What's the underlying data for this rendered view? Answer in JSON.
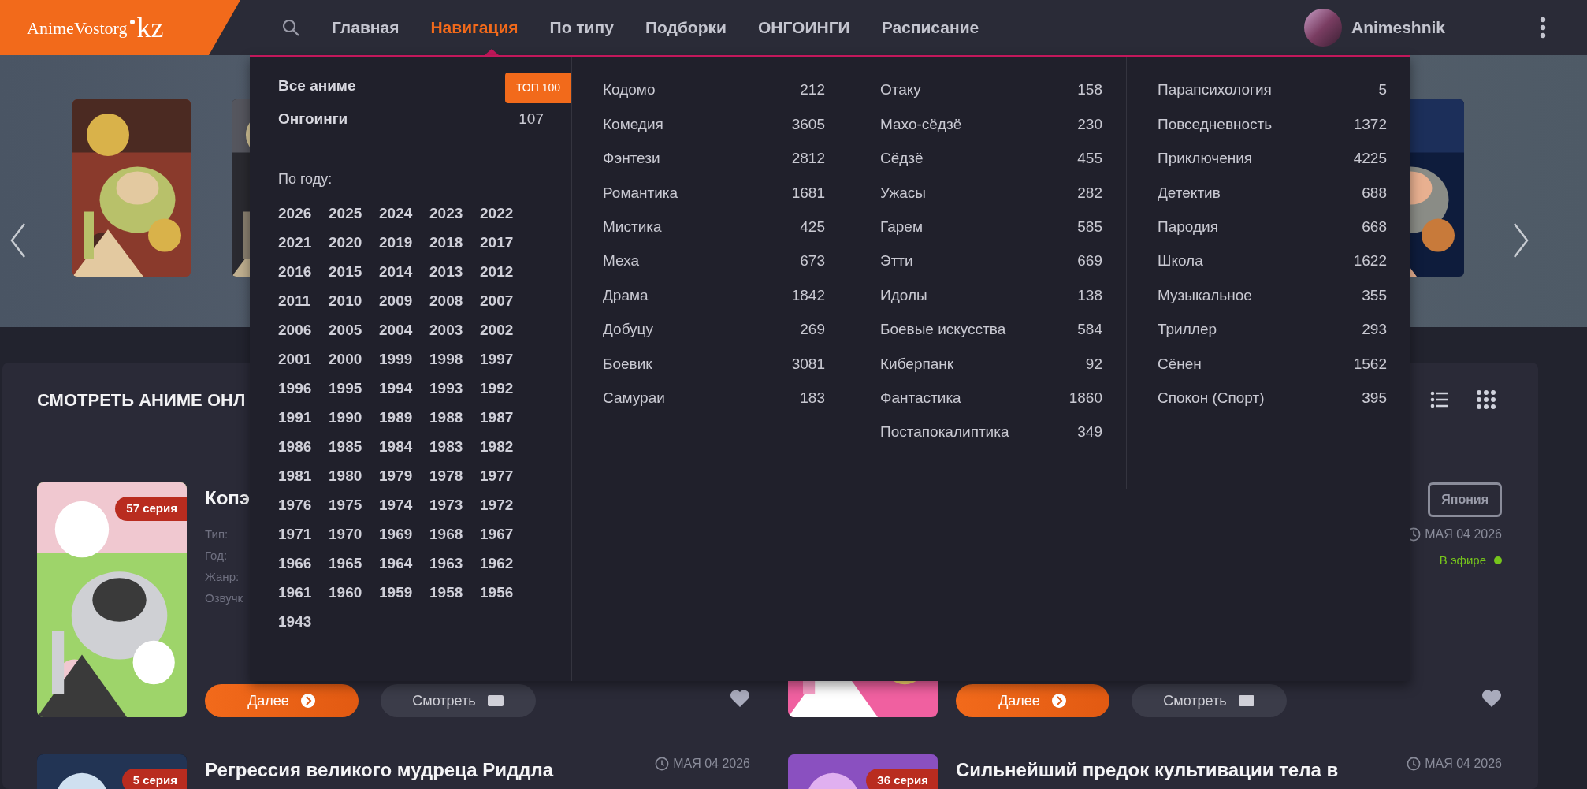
{
  "header": {
    "logo": "AnimeVostorg",
    "logo_domain": "kz",
    "nav": [
      {
        "label": "Главная",
        "selected": false
      },
      {
        "label": "Навигация",
        "selected": true
      },
      {
        "label": "По типу",
        "selected": false
      },
      {
        "label": "Подборки",
        "selected": false
      },
      {
        "label": "ОНГОИНГИ",
        "selected": false
      },
      {
        "label": "Расписание",
        "selected": false
      }
    ],
    "user": "Animeshnik"
  },
  "menu": {
    "all": "Все аниме",
    "top_badge": "ТОП 100",
    "ongoing": {
      "label": "Онгоинги",
      "count": "107"
    },
    "years_label": "По году:",
    "years": [
      "2026",
      "2025",
      "2024",
      "2023",
      "2022",
      "2021",
      "2020",
      "2019",
      "2018",
      "2017",
      "2016",
      "2015",
      "2014",
      "2013",
      "2012",
      "2011",
      "2010",
      "2009",
      "2008",
      "2007",
      "2006",
      "2005",
      "2004",
      "2003",
      "2002",
      "2001",
      "2000",
      "1999",
      "1998",
      "1997",
      "1996",
      "1995",
      "1994",
      "1993",
      "1992",
      "1991",
      "1990",
      "1989",
      "1988",
      "1987",
      "1986",
      "1985",
      "1984",
      "1983",
      "1982",
      "1981",
      "1980",
      "1979",
      "1978",
      "1977",
      "1976",
      "1975",
      "1974",
      "1973",
      "1972",
      "1971",
      "1970",
      "1969",
      "1968",
      "1967",
      "1966",
      "1965",
      "1964",
      "1963",
      "1962",
      "1961",
      "1960",
      "1959",
      "1958",
      "1956",
      "1943"
    ],
    "genre_columns": [
      [
        {
          "name": "Кодомо",
          "count": "212"
        },
        {
          "name": "Комедия",
          "count": "3605"
        },
        {
          "name": "Фэнтези",
          "count": "2812"
        },
        {
          "name": "Романтика",
          "count": "1681"
        },
        {
          "name": "Мистика",
          "count": "425"
        },
        {
          "name": "Меха",
          "count": "673"
        },
        {
          "name": "Драма",
          "count": "1842"
        },
        {
          "name": "Добуцу",
          "count": "269"
        },
        {
          "name": "Боевик",
          "count": "3081"
        },
        {
          "name": "Самураи",
          "count": "183"
        }
      ],
      [
        {
          "name": "Отаку",
          "count": "158"
        },
        {
          "name": "Махо-сёдзё",
          "count": "230"
        },
        {
          "name": "Сёдзё",
          "count": "455"
        },
        {
          "name": "Ужасы",
          "count": "282"
        },
        {
          "name": "Гарем",
          "count": "585"
        },
        {
          "name": "Этти",
          "count": "669"
        },
        {
          "name": "Идолы",
          "count": "138"
        },
        {
          "name": "Боевые искусства",
          "count": "584"
        },
        {
          "name": "Киберпанк",
          "count": "92"
        },
        {
          "name": "Фантастика",
          "count": "1860"
        },
        {
          "name": "Постапокалиптика",
          "count": "349"
        }
      ],
      [
        {
          "name": "Парапсихология",
          "count": "5"
        },
        {
          "name": "Повседневность",
          "count": "1372"
        },
        {
          "name": "Приключения",
          "count": "4225"
        },
        {
          "name": "Детектив",
          "count": "688"
        },
        {
          "name": "Пародия",
          "count": "668"
        },
        {
          "name": "Школа",
          "count": "1622"
        },
        {
          "name": "Музыкальное",
          "count": "355"
        },
        {
          "name": "Триллер",
          "count": "293"
        },
        {
          "name": "Сёнен",
          "count": "1562"
        },
        {
          "name": "Спокон (Спорт)",
          "count": "395"
        }
      ]
    ]
  },
  "section": {
    "title": "СМОТРЕТЬ АНИМЕ ОНЛ"
  },
  "cards": [
    {
      "badge": "57 серия",
      "title": "Копэ",
      "fields": [
        "Тип:",
        "Год:",
        "Жанр:",
        "Озвучк"
      ],
      "buttons": [
        "Далее",
        "Смотреть"
      ]
    },
    {
      "country": "Япония",
      "date": "МАЯ 04 2026",
      "status": "В эфире",
      "buttons": [
        "Далее",
        "Смотреть"
      ]
    },
    {
      "badge": "5 серия",
      "title": "Регрессия великого мудреца Риддла",
      "date": "МАЯ 04 2026"
    },
    {
      "badge": "36 серия",
      "title": "Сильнейший предок культивации тела в",
      "date": "МАЯ 04 2026"
    }
  ]
}
